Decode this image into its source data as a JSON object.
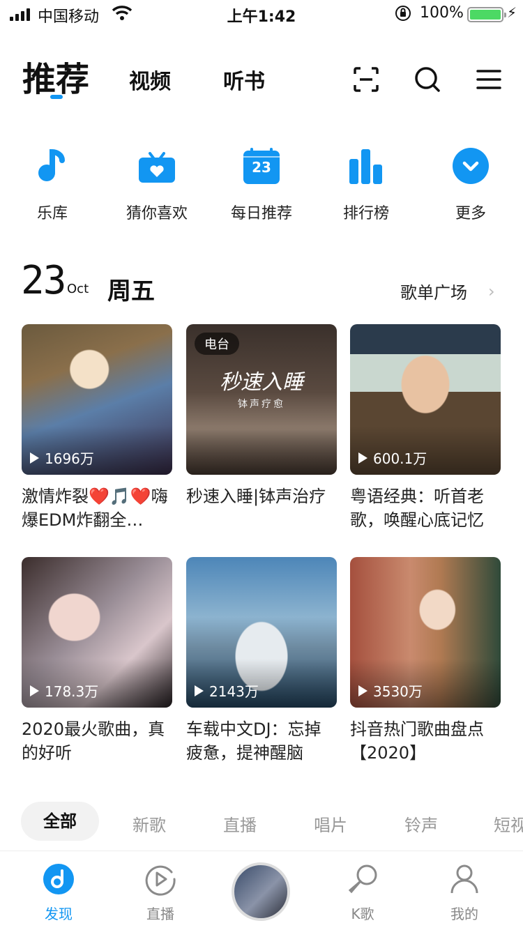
{
  "status": {
    "carrier": "中国移动",
    "time": "上午1:42",
    "battery": "100%"
  },
  "nav": {
    "tabs": [
      "推荐",
      "视频",
      "听书"
    ]
  },
  "quick": [
    {
      "label": "乐库",
      "icon": "music-note-icon"
    },
    {
      "label": "猜你喜欢",
      "icon": "radio-heart-icon"
    },
    {
      "label": "每日推荐",
      "icon": "calendar-icon",
      "day": "23"
    },
    {
      "label": "排行榜",
      "icon": "bar-chart-icon"
    },
    {
      "label": "更多",
      "icon": "chevron-down-circle-icon"
    }
  ],
  "date": {
    "day": "23",
    "month": "Oct",
    "weekday": "周五",
    "plaza": "歌单广场"
  },
  "cards": [
    {
      "title": "激情炸裂❤️🎵❤️嗨爆EDM炸翻全…",
      "plays": "1696万",
      "badge": ""
    },
    {
      "title": "秒速入睡|钵声治疗",
      "plays": "",
      "badge": "电台",
      "cover_title": "秒速入睡",
      "cover_sub": "钵声疗愈"
    },
    {
      "title": "粤语经典：听首老歌，唤醒心底记忆",
      "plays": "600.1万",
      "badge": ""
    },
    {
      "title": "2020最火歌曲，真的好听",
      "plays": "178.3万",
      "badge": ""
    },
    {
      "title": "车载中文DJ：忘掉疲惫，提神醒脑",
      "plays": "2143万",
      "badge": ""
    },
    {
      "title": "抖音热门歌曲盘点【2020】",
      "plays": "3530万",
      "badge": ""
    }
  ],
  "categories": [
    "全部",
    "新歌",
    "直播",
    "唱片",
    "铃声",
    "短视"
  ],
  "bottom": [
    {
      "label": "发现",
      "active": true
    },
    {
      "label": "直播"
    },
    {
      "label": ""
    },
    {
      "label": "K歌"
    },
    {
      "label": "我的"
    }
  ],
  "colors": {
    "accent": "#1296f2"
  }
}
